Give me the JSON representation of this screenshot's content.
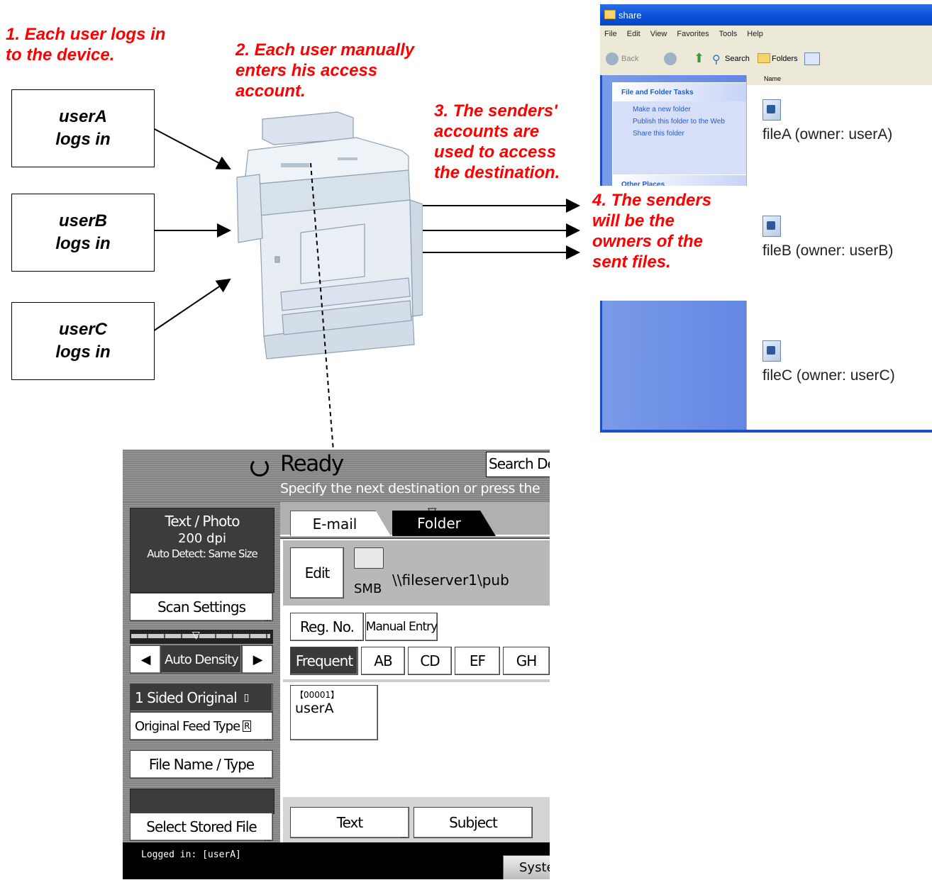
{
  "steps": {
    "s1": "1. Each user logs in\nto the device.",
    "s2": "2. Each user manually\nenters his access\naccount.",
    "s3": "3. The senders'\naccounts are\nused to access\nthe destination.",
    "s4": "4. The senders\nwill be the\nowners of the\nsent files."
  },
  "users": [
    "userA\nlogs in",
    "userB\nlogs in",
    "userC\nlogs in"
  ],
  "explorer": {
    "title": "share",
    "menu": [
      "File",
      "Edit",
      "View",
      "Favorites",
      "Tools",
      "Help"
    ],
    "toolbar": [
      "Back",
      "Search",
      "Folders"
    ],
    "column": "Name",
    "panel1_title": "File and Folder Tasks",
    "panel1_items": [
      "Make a new folder",
      "Publish this folder to the Web",
      "Share this folder"
    ],
    "panel2_title": "Other Places",
    "files": [
      "fileA (owner: userA)",
      "fileB (owner: userB)",
      "fileC (owner: userC)"
    ]
  },
  "panel": {
    "status": "Ready",
    "search_button": "Search De",
    "hint": "Specify the next destination or press the",
    "scan_mode": "Text / Photo",
    "resolution": "200 dpi",
    "size_mode": "Auto Detect: Same Size",
    "scan_settings": "Scan Settings",
    "density": "Auto Density",
    "sided": "1 Sided Original",
    "feed_type": "Original Feed Type",
    "file_name": "File Name / Type",
    "select_stored": "Select Stored File",
    "tab_email": "E-mail",
    "tab_folder": "Folder",
    "edit": "Edit",
    "protocol": "SMB",
    "path": "\\\\fileserver1\\pub",
    "reg_no": "Reg. No.",
    "manual_entry": "Manual Entry",
    "index_tabs": [
      "Frequent",
      "AB",
      "CD",
      "EF",
      "GH"
    ],
    "entry_id": "【00001】",
    "entry_name": "userA",
    "text_button": "Text",
    "subject_button": "Subject",
    "logged_in": "Logged in: [userA]",
    "system_button": "System"
  }
}
